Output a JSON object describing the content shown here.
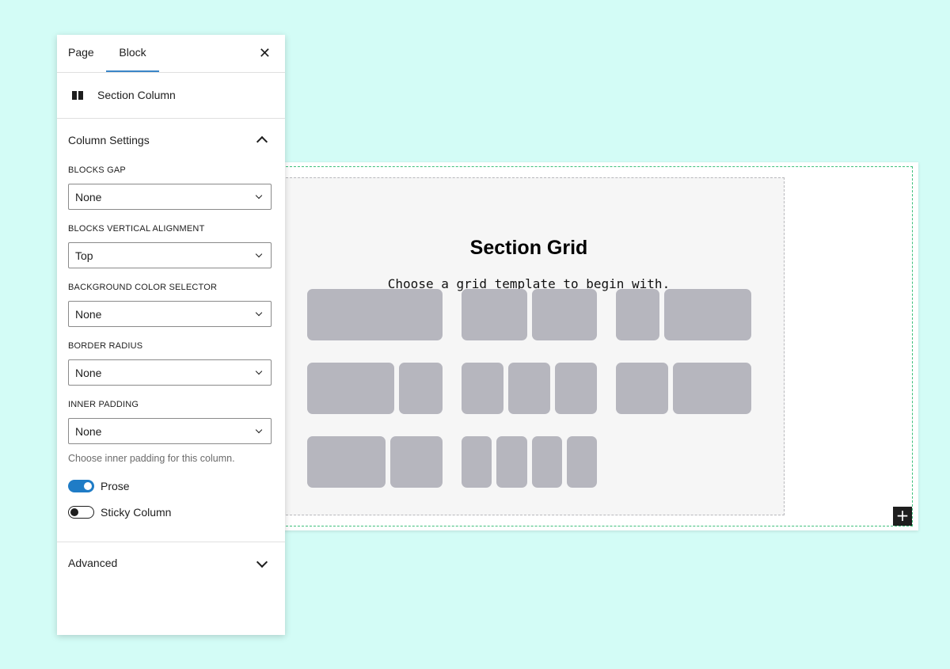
{
  "sidebar": {
    "tabs": [
      {
        "label": "Page"
      },
      {
        "label": "Block",
        "active": true
      }
    ],
    "close_icon": "close-icon",
    "block": {
      "icon": "columns-icon",
      "name": "Section Column"
    },
    "panel": {
      "title": "Column Settings",
      "expanded": true,
      "fields": [
        {
          "label": "BLOCKS GAP",
          "value": "None"
        },
        {
          "label": "BLOCKS VERTICAL ALIGNMENT",
          "value": "Top"
        },
        {
          "label": "BACKGROUND COLOR SELECTOR",
          "value": "None"
        },
        {
          "label": "BORDER RADIUS",
          "value": "None"
        },
        {
          "label": "INNER PADDING",
          "value": "None"
        }
      ],
      "help_text": "Choose inner padding for this column.",
      "toggles": [
        {
          "label": "Prose",
          "on": true
        },
        {
          "label": "Sticky Column",
          "on": false
        }
      ]
    },
    "advanced": {
      "title": "Advanced",
      "expanded": false
    }
  },
  "canvas": {
    "title": "Section Grid",
    "subtitle": "Choose a grid template to begin with.",
    "templates": [
      {
        "name": "1 column",
        "ratios": [
          1
        ]
      },
      {
        "name": "2 columns equal",
        "ratios": [
          1,
          1
        ]
      },
      {
        "name": "2 columns 1/3 + 2/3",
        "ratios": [
          1,
          2
        ]
      },
      {
        "name": "2 columns 2/3 + 1/3",
        "ratios": [
          2,
          1
        ]
      },
      {
        "name": "3 columns equal",
        "ratios": [
          1,
          1,
          1
        ]
      },
      {
        "name": "2 columns 40/60",
        "ratios": [
          2,
          3
        ]
      },
      {
        "name": "2 columns 60/40",
        "ratios": [
          3,
          2
        ]
      },
      {
        "name": "4 columns equal",
        "ratios": [
          1,
          1,
          1,
          1
        ]
      }
    ],
    "add_icon": "plus-icon"
  },
  "colors": {
    "background": "#d3fcf6",
    "accent": "#1f7cc6",
    "template_cell": "#b6b6be",
    "outline": "#3ec07c"
  }
}
